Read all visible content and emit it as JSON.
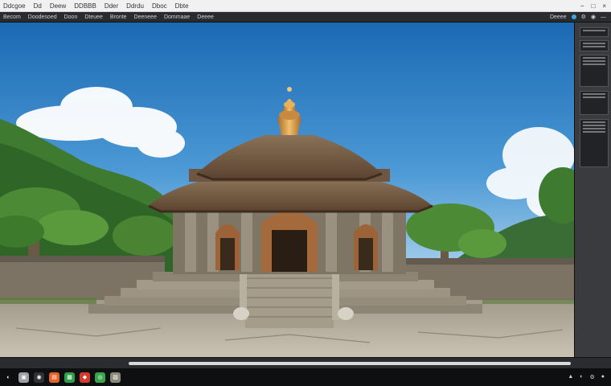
{
  "menubar": {
    "items": [
      "Ddcgoe",
      "Dd",
      "Deew",
      "DDBBB",
      "Dder",
      "Ddrdu",
      "Dboc",
      "Dbte"
    ],
    "win_controls": [
      "−",
      "□",
      "×"
    ]
  },
  "toolbar": {
    "items": [
      "Becom",
      "Doodesoed",
      "Doon",
      "Dteuee",
      "Bronte",
      "Deeneee",
      "Dommaae",
      "Deeee"
    ],
    "status": [
      "Deeee",
      "⚙",
      "◉",
      "—"
    ]
  },
  "taskbar": {
    "icons": [
      {
        "name": "start-icon",
        "glyph": "◐",
        "color": "#0e0f10"
      },
      {
        "name": "files-icon",
        "glyph": "▣",
        "color": "#9aa0a6"
      },
      {
        "name": "browser-icon",
        "glyph": "◉",
        "color": "#2f3134"
      },
      {
        "name": "office-icon",
        "glyph": "▤",
        "color": "#e2622b"
      },
      {
        "name": "sheets-icon",
        "glyph": "▦",
        "color": "#2e9e4a"
      },
      {
        "name": "pdf-icon",
        "glyph": "◆",
        "color": "#d43b2a"
      },
      {
        "name": "chrome-icon",
        "glyph": "◎",
        "color": "#3aa44d"
      },
      {
        "name": "image-icon",
        "glyph": "▨",
        "color": "#8a8a7a"
      }
    ],
    "tray": [
      "▲",
      "◐",
      "⚙",
      "●"
    ]
  },
  "colors": {
    "sky_top": "#1f6fb8",
    "roof": "#6b4a33",
    "stone": "#8c8272",
    "foliage": "#3e7a2c",
    "finial": "#d39a4a"
  }
}
